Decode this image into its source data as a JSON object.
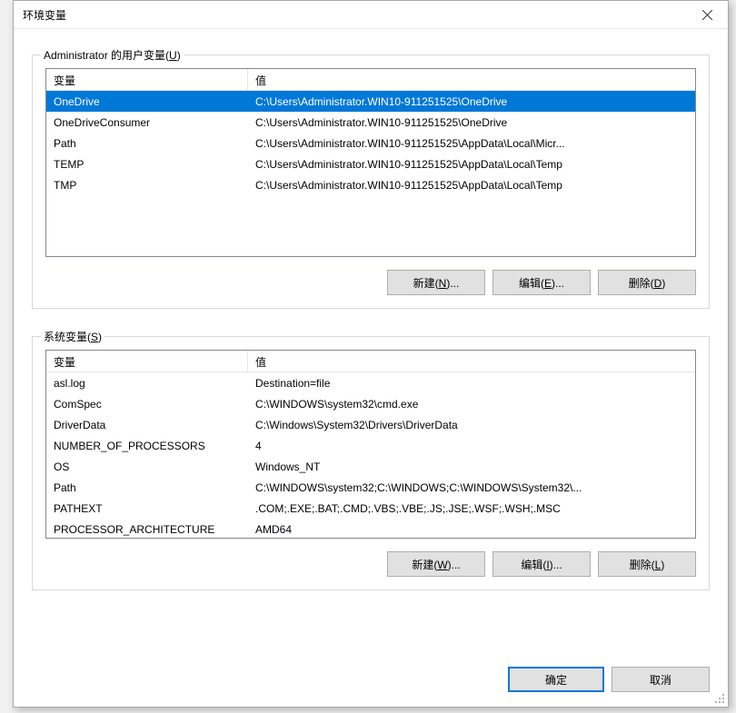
{
  "dialog": {
    "title": "环境变量"
  },
  "user_section": {
    "label_prefix": "Administrator 的用户变量(",
    "label_hotkey": "U",
    "label_suffix": ")",
    "headers": {
      "var": "变量",
      "val": "值"
    },
    "rows": [
      {
        "var": "OneDrive",
        "val": "C:\\Users\\Administrator.WIN10-911251525\\OneDrive",
        "selected": true
      },
      {
        "var": "OneDriveConsumer",
        "val": "C:\\Users\\Administrator.WIN10-911251525\\OneDrive",
        "selected": false
      },
      {
        "var": "Path",
        "val": "C:\\Users\\Administrator.WIN10-911251525\\AppData\\Local\\Micr...",
        "selected": false
      },
      {
        "var": "TEMP",
        "val": "C:\\Users\\Administrator.WIN10-911251525\\AppData\\Local\\Temp",
        "selected": false
      },
      {
        "var": "TMP",
        "val": "C:\\Users\\Administrator.WIN10-911251525\\AppData\\Local\\Temp",
        "selected": false
      }
    ],
    "buttons": {
      "new_prefix": "新建(",
      "new_hotkey": "N",
      "new_suffix": ")...",
      "edit_prefix": "编辑(",
      "edit_hotkey": "E",
      "edit_suffix": ")...",
      "delete_prefix": "删除(",
      "delete_hotkey": "D",
      "delete_suffix": ")"
    }
  },
  "system_section": {
    "label_prefix": "系统变量(",
    "label_hotkey": "S",
    "label_suffix": ")",
    "headers": {
      "var": "变量",
      "val": "值"
    },
    "rows": [
      {
        "var": "asl.log",
        "val": "Destination=file"
      },
      {
        "var": "ComSpec",
        "val": "C:\\WINDOWS\\system32\\cmd.exe"
      },
      {
        "var": "DriverData",
        "val": "C:\\Windows\\System32\\Drivers\\DriverData"
      },
      {
        "var": "NUMBER_OF_PROCESSORS",
        "val": "4"
      },
      {
        "var": "OS",
        "val": "Windows_NT"
      },
      {
        "var": "Path",
        "val": "C:\\WINDOWS\\system32;C:\\WINDOWS;C:\\WINDOWS\\System32\\..."
      },
      {
        "var": "PATHEXT",
        "val": ".COM;.EXE;.BAT;.CMD;.VBS;.VBE;.JS;.JSE;.WSF;.WSH;.MSC"
      },
      {
        "var": "PROCESSOR_ARCHITECTURE",
        "val": "AMD64"
      }
    ],
    "buttons": {
      "new_prefix": "新建(",
      "new_hotkey": "W",
      "new_suffix": ")...",
      "edit_prefix": "编辑(",
      "edit_hotkey": "I",
      "edit_suffix": ")...",
      "delete_prefix": "删除(",
      "delete_hotkey": "L",
      "delete_suffix": ")"
    }
  },
  "footer": {
    "ok": "确定",
    "cancel": "取消"
  }
}
